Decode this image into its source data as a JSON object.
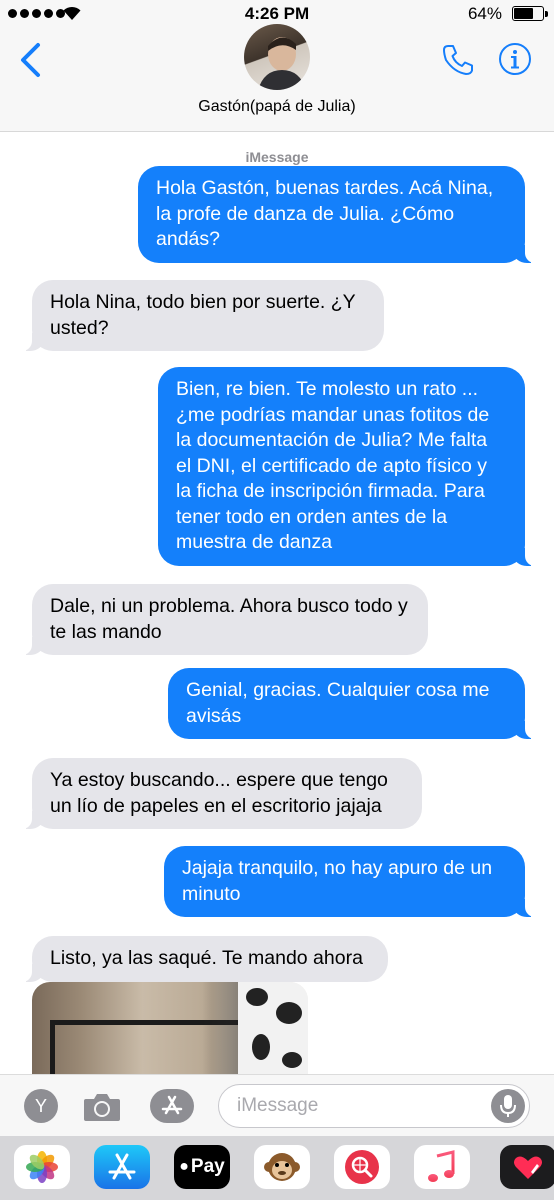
{
  "status_bar": {
    "time": "4:26 PM",
    "battery_percent": "64%",
    "battery_level": 0.64,
    "signal_bars": 5
  },
  "header": {
    "contact_name": "Gastón(papá de Julia)",
    "icons": [
      "chevron-left-icon",
      "phone-icon",
      "info-icon"
    ]
  },
  "conversation": {
    "service_label": "iMessage",
    "messages": [
      {
        "direction": "sent",
        "text": "Hola Gastón, buenas tardes. Acá Nina, la profe de danza de Julia. ¿Cómo andás?"
      },
      {
        "direction": "received",
        "text": "Hola Nina, todo bien por suerte. ¿Y usted?"
      },
      {
        "direction": "sent",
        "text": "Bien, re bien. Te molesto un rato ... ¿me podrías mandar unas fotitos de la documentación de Julia? Me falta el DNI, el certificado de apto físico y la ficha de inscripción firmada. Para tener todo en orden antes de la muestra de danza"
      },
      {
        "direction": "received",
        "text": "Dale, ni un problema. Ahora busco todo y te las mando"
      },
      {
        "direction": "sent",
        "text": "Genial, gracias. Cualquier cosa me avisás"
      },
      {
        "direction": "received",
        "text": "Ya estoy buscando... espere que tengo un lío de papeles en el escritorio jajaja"
      },
      {
        "direction": "sent",
        "text": "Jajaja tranquilo, no hay apuro de un minuto"
      },
      {
        "direction": "received",
        "text": "Listo, ya las saqué. Te mando ahora"
      }
    ]
  },
  "composer": {
    "memoji_letter": "Y",
    "placeholder": "iMessage",
    "value": ""
  },
  "app_drawer": {
    "apps": [
      "photos-icon",
      "app-store-icon",
      "apple-pay-icon",
      "monkey-animoji-icon",
      "web-search-icon",
      "music-icon",
      "digital-touch-icon"
    ],
    "apple_pay_label": "Pay"
  },
  "colors": {
    "sent_bubble": "#1480fb",
    "received_bubble": "#e5e5ea",
    "ios_blue": "#157efb"
  }
}
